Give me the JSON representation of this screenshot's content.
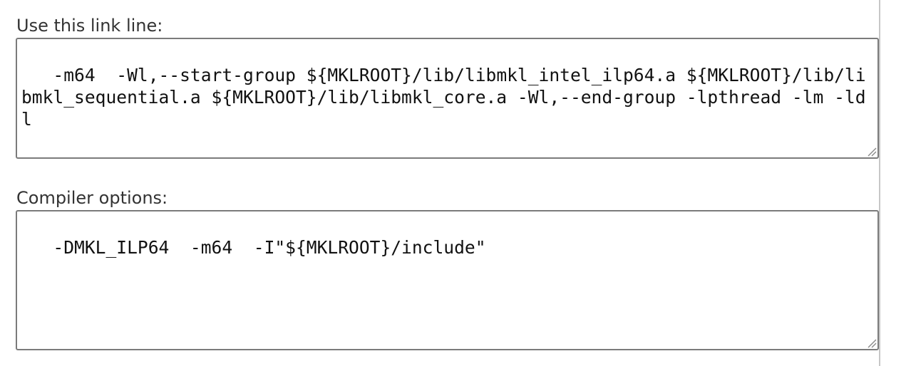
{
  "link_line": {
    "label": "Use this link line:",
    "value": " -m64  -Wl,--start-group ${MKLROOT}/lib/libmkl_intel_ilp64.a ${MKLROOT}/lib/libmkl_sequential.a ${MKLROOT}/lib/libmkl_core.a -Wl,--end-group -lpthread -lm -ldl"
  },
  "compiler_options": {
    "label": "Compiler options:",
    "value": " -DMKL_ILP64  -m64  -I\"${MKLROOT}/include\""
  },
  "icons": {
    "resize_grip": "resize-grip-icon"
  }
}
